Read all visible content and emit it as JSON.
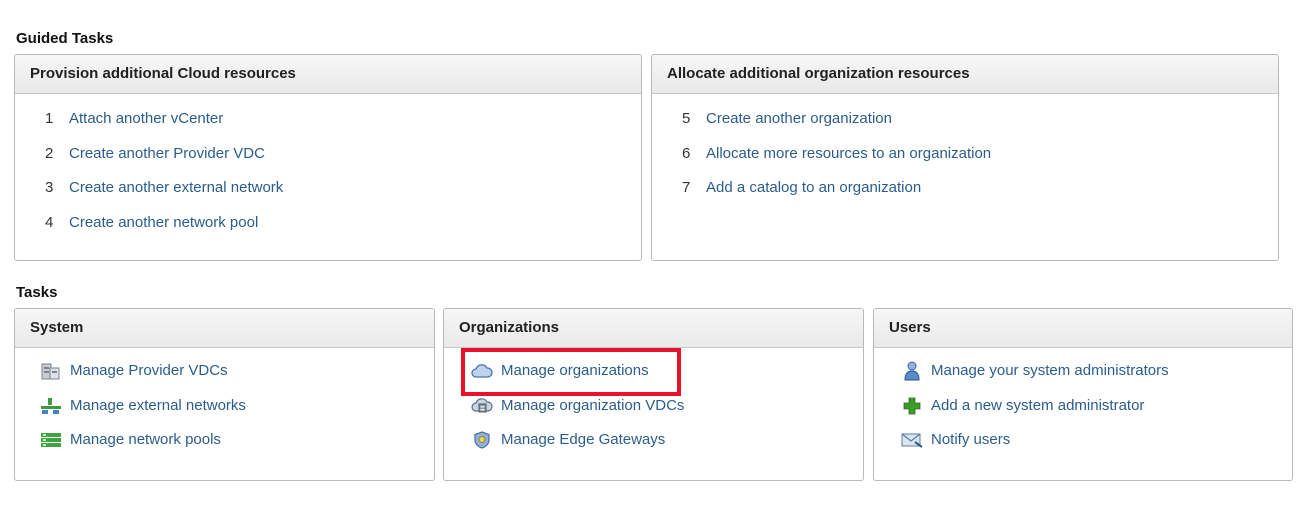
{
  "guided": {
    "title": "Guided Tasks",
    "panels": [
      {
        "header": "Provision additional Cloud resources",
        "items": [
          {
            "num": "1",
            "label": "Attach another vCenter"
          },
          {
            "num": "2",
            "label": "Create another Provider VDC"
          },
          {
            "num": "3",
            "label": "Create another external network"
          },
          {
            "num": "4",
            "label": "Create another network pool"
          }
        ]
      },
      {
        "header": "Allocate additional organization resources",
        "items": [
          {
            "num": "5",
            "label": "Create another organization"
          },
          {
            "num": "6",
            "label": "Allocate more resources to an organization"
          },
          {
            "num": "7",
            "label": "Add a catalog to an organization"
          }
        ]
      }
    ]
  },
  "tasks": {
    "title": "Tasks",
    "panels": [
      {
        "header": "System",
        "items": [
          {
            "icon": "provider-vdc-icon",
            "label": "Manage Provider VDCs"
          },
          {
            "icon": "external-network-icon",
            "label": "Manage external networks"
          },
          {
            "icon": "network-pool-icon",
            "label": "Manage network pools"
          }
        ]
      },
      {
        "header": "Organizations",
        "items": [
          {
            "icon": "cloud-icon",
            "label": "Manage organizations"
          },
          {
            "icon": "org-vdc-icon",
            "label": "Manage organization VDCs"
          },
          {
            "icon": "shield-icon",
            "label": "Manage Edge Gateways"
          }
        ]
      },
      {
        "header": "Users",
        "items": [
          {
            "icon": "admin-user-icon",
            "label": "Manage your system administrators"
          },
          {
            "icon": "green-plus-icon",
            "label": "Add a new system administrator"
          },
          {
            "icon": "mail-icon",
            "label": "Notify users"
          }
        ]
      }
    ]
  },
  "colors": {
    "link": "#2a5d8c",
    "highlight": "#e8132b",
    "header_bg": "#eeeeee",
    "border": "#b8b8b8"
  }
}
